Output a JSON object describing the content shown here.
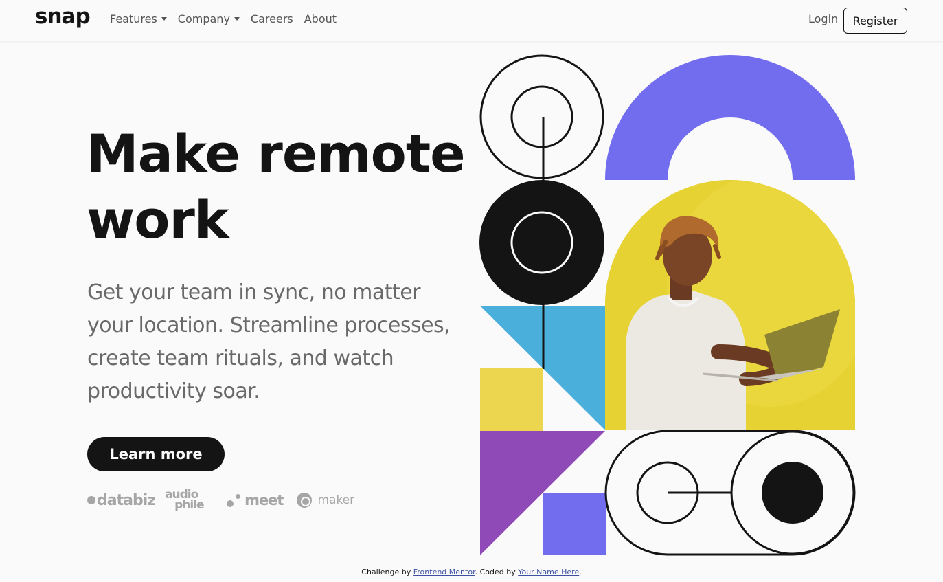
{
  "brand": {
    "logo": "snap"
  },
  "nav": {
    "items": [
      {
        "label": "Features",
        "has_dropdown": true
      },
      {
        "label": "Company",
        "has_dropdown": true
      },
      {
        "label": "Careers",
        "has_dropdown": false
      },
      {
        "label": "About",
        "has_dropdown": false
      }
    ],
    "login": "Login",
    "register": "Register"
  },
  "hero": {
    "title_line1": "Make remote",
    "title_line2": "work",
    "subtitle": "Get your team in sync, no matter your location. Streamline processes, create team rituals, and watch productivity soar.",
    "cta": "Learn more"
  },
  "clients": {
    "databiz": "databiz",
    "audiophile_1": "audio",
    "audiophile_2": "phile",
    "meet": "meet",
    "maker": "maker"
  },
  "footer": {
    "prefix": "Challenge by ",
    "link1": "Frontend Mentor",
    "middle": ". Coded by ",
    "link2": "Your Name Here",
    "suffix": "."
  },
  "colors": {
    "dark": "#141414",
    "purple": "#726cee",
    "blue": "#4bafdc",
    "yellow": "#ecd54f",
    "violet": "#904ab8",
    "muted_text": "#696969",
    "logo_gray": "#a6a6a6"
  }
}
